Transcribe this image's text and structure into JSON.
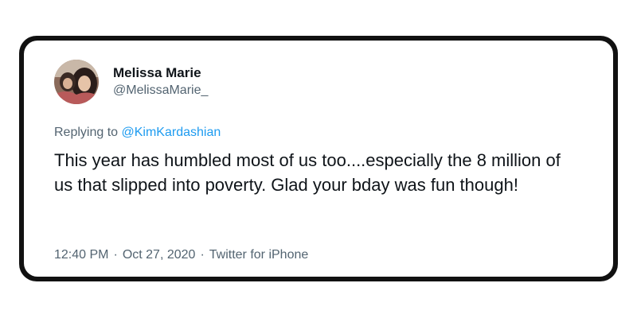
{
  "tweet": {
    "author": {
      "display_name": "Melissa Marie",
      "handle": "@MelissaMarie_"
    },
    "reply_prefix": "Replying to",
    "reply_to": "@KimKardashian",
    "text": "This year has humbled most of us too....especially the 8 million of us that slipped into poverty. Glad your bday was fun though!",
    "time": "12:40 PM",
    "separator_1": "·",
    "date": "Oct 27, 2020",
    "separator_2": "·",
    "source": "Twitter for iPhone"
  },
  "colors": {
    "frame": "#111111",
    "text": "#0f1419",
    "muted": "#536471",
    "link": "#1d9bf0"
  }
}
